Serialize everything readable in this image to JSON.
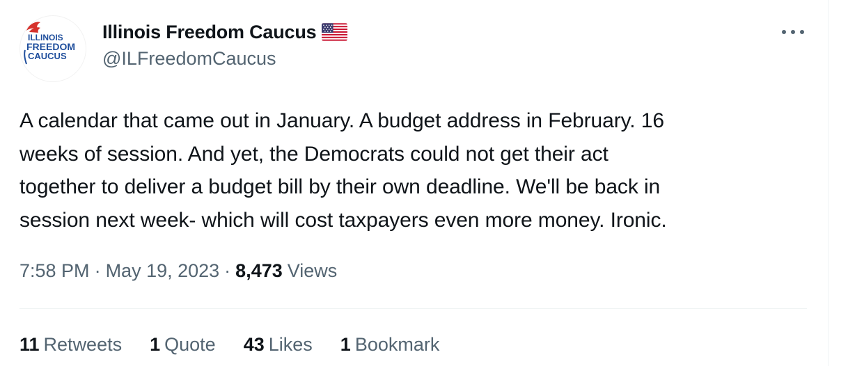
{
  "author": {
    "display_name": "Illinois Freedom Caucus",
    "handle": "@ILFreedomCaucus",
    "verified_flag_icon": "us-flag-icon",
    "avatar": {
      "line1": "ILLINOIS",
      "line2": "FREEDOM",
      "line3": "CAUCUS"
    }
  },
  "more_icon": "more-horizontal-icon",
  "tweet": {
    "text": "A calendar that came out in January. A budget address in February. 16\nweeks of session.  And yet, the Democrats could not get their act\ntogether to deliver a budget bill by their own deadline. We'll be back in\nsession next week- which will cost taxpayers even more money. Ironic."
  },
  "meta": {
    "time": "7:58 PM",
    "separator": "·",
    "date": "May 19, 2023",
    "views_count": "8,473",
    "views_label": "Views"
  },
  "stats": [
    {
      "count": "11",
      "label": "Retweets"
    },
    {
      "count": "1",
      "label": "Quote"
    },
    {
      "count": "43",
      "label": "Likes"
    },
    {
      "count": "1",
      "label": "Bookmark"
    }
  ],
  "colors": {
    "text_primary": "#0f1419",
    "text_secondary": "#536471",
    "divider": "#eff3f4",
    "logo_blue": "#1f4e9c",
    "logo_red": "#d6322c"
  }
}
